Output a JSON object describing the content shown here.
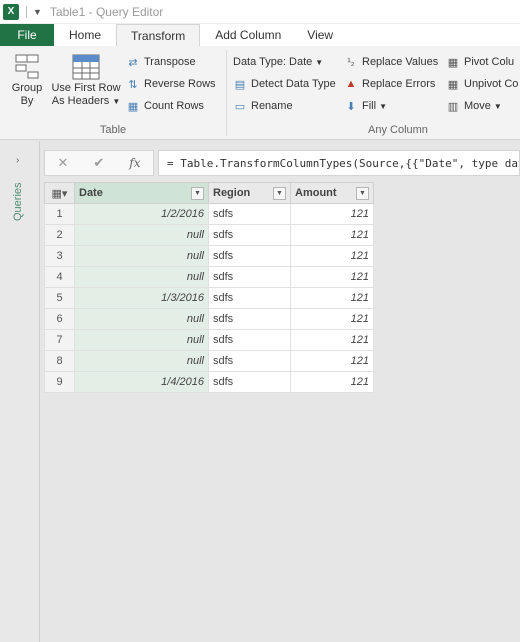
{
  "window": {
    "title": "Table1 - Query Editor",
    "app_icon": "X"
  },
  "tabs": [
    {
      "label": "File"
    },
    {
      "label": "Home"
    },
    {
      "label": "Transform"
    },
    {
      "label": "Add Column"
    },
    {
      "label": "View"
    }
  ],
  "ribbon": {
    "table_group": {
      "label": "Table",
      "group_by": "Group\nBy",
      "use_first_row_line1": "Use First Row",
      "use_first_row_line2": "As Headers",
      "transpose": "Transpose",
      "reverse_rows": "Reverse Rows",
      "count_rows": "Count Rows"
    },
    "any_column_group": {
      "label": "Any Column",
      "data_type": "Data Type: Date",
      "detect_data_type": "Detect Data Type",
      "rename": "Rename",
      "replace_values": "Replace Values",
      "replace_errors": "Replace Errors",
      "fill": "Fill",
      "pivot_column": "Pivot Colu",
      "unpivot_columns": "Unpivot Co",
      "move": "Move"
    }
  },
  "left_panel": {
    "label": "Queries"
  },
  "formula_bar": {
    "fx": "fx",
    "formula": "= Table.TransformColumnTypes(Source,{{\"Date\", type dat"
  },
  "table": {
    "columns": [
      "Date",
      "Region",
      "Amount"
    ],
    "rows": [
      {
        "n": "1",
        "date": "1/2/2016",
        "region": "sdfs",
        "amount": "121"
      },
      {
        "n": "2",
        "date": "null",
        "region": "sdfs",
        "amount": "121"
      },
      {
        "n": "3",
        "date": "null",
        "region": "sdfs",
        "amount": "121"
      },
      {
        "n": "4",
        "date": "null",
        "region": "sdfs",
        "amount": "121"
      },
      {
        "n": "5",
        "date": "1/3/2016",
        "region": "sdfs",
        "amount": "121"
      },
      {
        "n": "6",
        "date": "null",
        "region": "sdfs",
        "amount": "121"
      },
      {
        "n": "7",
        "date": "null",
        "region": "sdfs",
        "amount": "121"
      },
      {
        "n": "8",
        "date": "null",
        "region": "sdfs",
        "amount": "121"
      },
      {
        "n": "9",
        "date": "1/4/2016",
        "region": "sdfs",
        "amount": "121"
      }
    ]
  },
  "colors": {
    "file_tab": "#217346",
    "selected_column": "#e2eee6",
    "queries_label": "#4d8c72"
  }
}
